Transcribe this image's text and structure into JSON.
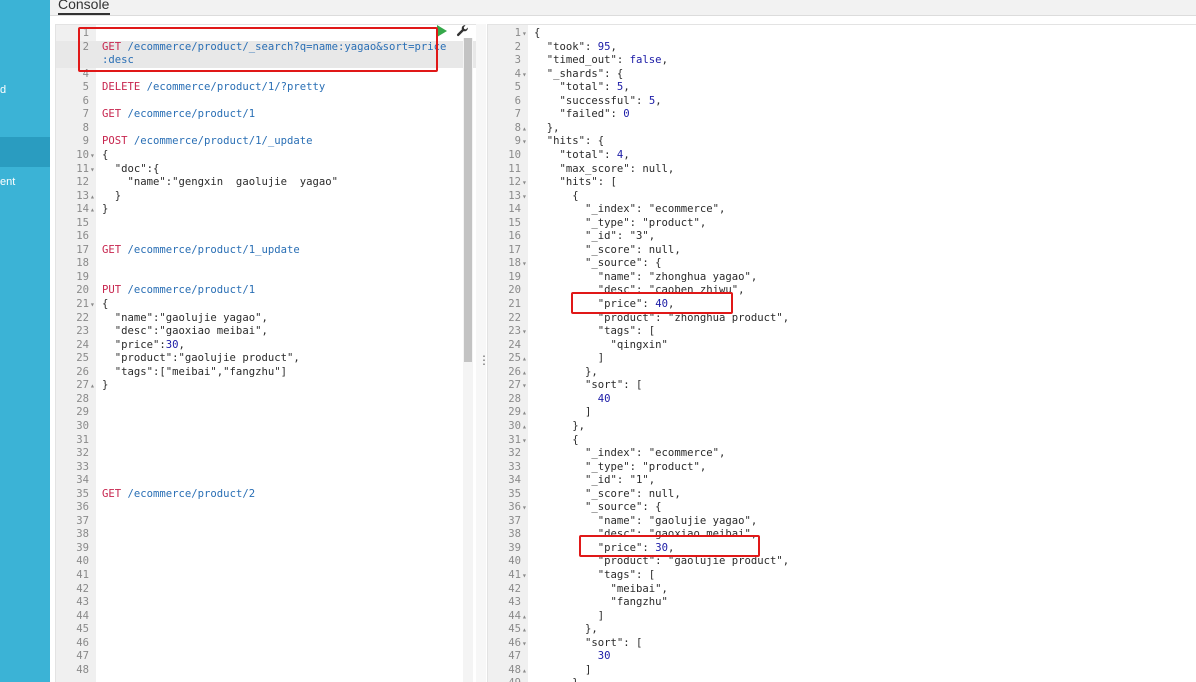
{
  "sidebar": {
    "items": [
      {
        "label": "d"
      },
      {
        "label": "ent"
      }
    ]
  },
  "tabs": {
    "console_label": "Console"
  },
  "request_editor": {
    "lines": [
      {
        "n": "1",
        "fold": "",
        "parts": []
      },
      {
        "n": "2",
        "fold": "",
        "parts": [
          {
            "c": "m",
            "t": "GET "
          },
          {
            "c": "u",
            "t": "/ecommerce/product/_search?q=name:yagao&sort=price"
          }
        ]
      },
      {
        "n": "",
        "fold": "",
        "parts": [
          {
            "c": "u",
            "t": ":desc"
          }
        ]
      },
      {
        "n": "4",
        "fold": "",
        "parts": []
      },
      {
        "n": "5",
        "fold": "",
        "parts": [
          {
            "c": "m",
            "t": "DELETE "
          },
          {
            "c": "u",
            "t": "/ecommerce/product/1/?pretty"
          }
        ]
      },
      {
        "n": "6",
        "fold": "",
        "parts": []
      },
      {
        "n": "7",
        "fold": "",
        "parts": [
          {
            "c": "m",
            "t": "GET "
          },
          {
            "c": "u",
            "t": "/ecommerce/product/1"
          }
        ]
      },
      {
        "n": "8",
        "fold": "",
        "parts": []
      },
      {
        "n": "9",
        "fold": "",
        "parts": [
          {
            "c": "m",
            "t": "POST "
          },
          {
            "c": "u",
            "t": "/ecommerce/product/1/_update"
          }
        ]
      },
      {
        "n": "10",
        "fold": "▾",
        "parts": [
          {
            "c": "k",
            "t": "{"
          }
        ]
      },
      {
        "n": "11",
        "fold": "▾",
        "parts": [
          {
            "c": "k",
            "t": "  \"doc\":{"
          }
        ]
      },
      {
        "n": "12",
        "fold": "",
        "parts": [
          {
            "c": "k",
            "t": "    \"name\":\"gengxin  gaolujie  yagao\""
          }
        ]
      },
      {
        "n": "13",
        "fold": "▴",
        "parts": [
          {
            "c": "k",
            "t": "  }"
          }
        ]
      },
      {
        "n": "14",
        "fold": "▴",
        "parts": [
          {
            "c": "k",
            "t": "}"
          }
        ]
      },
      {
        "n": "15",
        "fold": "",
        "parts": []
      },
      {
        "n": "16",
        "fold": "",
        "parts": []
      },
      {
        "n": "17",
        "fold": "",
        "parts": [
          {
            "c": "m",
            "t": "GET "
          },
          {
            "c": "u",
            "t": "/ecommerce/product/1_update"
          }
        ]
      },
      {
        "n": "18",
        "fold": "",
        "parts": []
      },
      {
        "n": "19",
        "fold": "",
        "parts": []
      },
      {
        "n": "20",
        "fold": "",
        "parts": [
          {
            "c": "m",
            "t": "PUT "
          },
          {
            "c": "u",
            "t": "/ecommerce/product/1"
          }
        ]
      },
      {
        "n": "21",
        "fold": "▾",
        "parts": [
          {
            "c": "k",
            "t": "{"
          }
        ]
      },
      {
        "n": "22",
        "fold": "",
        "parts": [
          {
            "c": "k",
            "t": "  \"name\":\"gaolujie yagao\","
          }
        ]
      },
      {
        "n": "23",
        "fold": "",
        "parts": [
          {
            "c": "k",
            "t": "  \"desc\":\"gaoxiao meibai\","
          }
        ]
      },
      {
        "n": "24",
        "fold": "",
        "parts": [
          {
            "c": "k",
            "t": "  \"price\":"
          },
          {
            "c": "n",
            "t": "30"
          },
          {
            "c": "k",
            "t": ","
          }
        ]
      },
      {
        "n": "25",
        "fold": "",
        "parts": [
          {
            "c": "k",
            "t": "  \"product\":\"gaolujie product\","
          }
        ]
      },
      {
        "n": "26",
        "fold": "",
        "parts": [
          {
            "c": "k",
            "t": "  \"tags\":[\"meibai\",\"fangzhu\"]"
          }
        ]
      },
      {
        "n": "27",
        "fold": "▴",
        "parts": [
          {
            "c": "k",
            "t": "}"
          }
        ]
      },
      {
        "n": "28",
        "fold": "",
        "parts": []
      },
      {
        "n": "29",
        "fold": "",
        "parts": []
      },
      {
        "n": "30",
        "fold": "",
        "parts": []
      },
      {
        "n": "31",
        "fold": "",
        "parts": []
      },
      {
        "n": "32",
        "fold": "",
        "parts": []
      },
      {
        "n": "33",
        "fold": "",
        "parts": []
      },
      {
        "n": "34",
        "fold": "",
        "parts": []
      },
      {
        "n": "35",
        "fold": "",
        "parts": [
          {
            "c": "m",
            "t": "GET "
          },
          {
            "c": "u",
            "t": "/ecommerce/product/2"
          }
        ]
      },
      {
        "n": "36",
        "fold": "",
        "parts": []
      },
      {
        "n": "37",
        "fold": "",
        "parts": []
      },
      {
        "n": "38",
        "fold": "",
        "parts": []
      },
      {
        "n": "39",
        "fold": "",
        "parts": []
      },
      {
        "n": "40",
        "fold": "",
        "parts": []
      },
      {
        "n": "41",
        "fold": "",
        "parts": []
      },
      {
        "n": "42",
        "fold": "",
        "parts": []
      },
      {
        "n": "43",
        "fold": "",
        "parts": []
      },
      {
        "n": "44",
        "fold": "",
        "parts": []
      },
      {
        "n": "45",
        "fold": "",
        "parts": []
      },
      {
        "n": "46",
        "fold": "",
        "parts": []
      },
      {
        "n": "47",
        "fold": "",
        "parts": []
      },
      {
        "n": "48",
        "fold": "",
        "parts": []
      }
    ]
  },
  "response_viewer": {
    "lines": [
      {
        "n": "1",
        "fold": "▾",
        "parts": [
          {
            "c": "k",
            "t": "{"
          }
        ]
      },
      {
        "n": "2",
        "fold": "",
        "parts": [
          {
            "c": "k",
            "t": "  \"took\": "
          },
          {
            "c": "n",
            "t": "95"
          },
          {
            "c": "k",
            "t": ","
          }
        ]
      },
      {
        "n": "3",
        "fold": "",
        "parts": [
          {
            "c": "k",
            "t": "  \"timed_out\": "
          },
          {
            "c": "b",
            "t": "false"
          },
          {
            "c": "k",
            "t": ","
          }
        ]
      },
      {
        "n": "4",
        "fold": "▾",
        "parts": [
          {
            "c": "k",
            "t": "  \"_shards\": {"
          }
        ]
      },
      {
        "n": "5",
        "fold": "",
        "parts": [
          {
            "c": "k",
            "t": "    \"total\": "
          },
          {
            "c": "n",
            "t": "5"
          },
          {
            "c": "k",
            "t": ","
          }
        ]
      },
      {
        "n": "6",
        "fold": "",
        "parts": [
          {
            "c": "k",
            "t": "    \"successful\": "
          },
          {
            "c": "n",
            "t": "5"
          },
          {
            "c": "k",
            "t": ","
          }
        ]
      },
      {
        "n": "7",
        "fold": "",
        "parts": [
          {
            "c": "k",
            "t": "    \"failed\": "
          },
          {
            "c": "n",
            "t": "0"
          }
        ]
      },
      {
        "n": "8",
        "fold": "▴",
        "parts": [
          {
            "c": "k",
            "t": "  },"
          }
        ]
      },
      {
        "n": "9",
        "fold": "▾",
        "parts": [
          {
            "c": "k",
            "t": "  \"hits\": {"
          }
        ]
      },
      {
        "n": "10",
        "fold": "",
        "parts": [
          {
            "c": "k",
            "t": "    \"total\": "
          },
          {
            "c": "n",
            "t": "4"
          },
          {
            "c": "k",
            "t": ","
          }
        ]
      },
      {
        "n": "11",
        "fold": "",
        "parts": [
          {
            "c": "k",
            "t": "    \"max_score\": null,"
          }
        ]
      },
      {
        "n": "12",
        "fold": "▾",
        "parts": [
          {
            "c": "k",
            "t": "    \"hits\": ["
          }
        ]
      },
      {
        "n": "13",
        "fold": "▾",
        "parts": [
          {
            "c": "k",
            "t": "      {"
          }
        ]
      },
      {
        "n": "14",
        "fold": "",
        "parts": [
          {
            "c": "k",
            "t": "        \"_index\": \"ecommerce\","
          }
        ]
      },
      {
        "n": "15",
        "fold": "",
        "parts": [
          {
            "c": "k",
            "t": "        \"_type\": \"product\","
          }
        ]
      },
      {
        "n": "16",
        "fold": "",
        "parts": [
          {
            "c": "k",
            "t": "        \"_id\": \"3\","
          }
        ]
      },
      {
        "n": "17",
        "fold": "",
        "parts": [
          {
            "c": "k",
            "t": "        \"_score\": null,"
          }
        ]
      },
      {
        "n": "18",
        "fold": "▾",
        "parts": [
          {
            "c": "k",
            "t": "        \"_source\": {"
          }
        ]
      },
      {
        "n": "19",
        "fold": "",
        "parts": [
          {
            "c": "k",
            "t": "          \"name\": \"zhonghua yagao\","
          }
        ]
      },
      {
        "n": "20",
        "fold": "",
        "parts": [
          {
            "c": "k",
            "t": "          \"desc\": \"caoben zhiwu\","
          }
        ]
      },
      {
        "n": "21",
        "fold": "",
        "parts": [
          {
            "c": "k",
            "t": "          \"price\": "
          },
          {
            "c": "n",
            "t": "40"
          },
          {
            "c": "k",
            "t": ","
          }
        ]
      },
      {
        "n": "22",
        "fold": "",
        "parts": [
          {
            "c": "k",
            "t": "          \"product\": \"zhonghua product\","
          }
        ]
      },
      {
        "n": "23",
        "fold": "▾",
        "parts": [
          {
            "c": "k",
            "t": "          \"tags\": ["
          }
        ]
      },
      {
        "n": "24",
        "fold": "",
        "parts": [
          {
            "c": "k",
            "t": "            \"qingxin\""
          }
        ]
      },
      {
        "n": "25",
        "fold": "▴",
        "parts": [
          {
            "c": "k",
            "t": "          ]"
          }
        ]
      },
      {
        "n": "26",
        "fold": "▴",
        "parts": [
          {
            "c": "k",
            "t": "        },"
          }
        ]
      },
      {
        "n": "27",
        "fold": "▾",
        "parts": [
          {
            "c": "k",
            "t": "        \"sort\": ["
          }
        ]
      },
      {
        "n": "28",
        "fold": "",
        "parts": [
          {
            "c": "k",
            "t": "          "
          },
          {
            "c": "n",
            "t": "40"
          }
        ]
      },
      {
        "n": "29",
        "fold": "▴",
        "parts": [
          {
            "c": "k",
            "t": "        ]"
          }
        ]
      },
      {
        "n": "30",
        "fold": "▴",
        "parts": [
          {
            "c": "k",
            "t": "      },"
          }
        ]
      },
      {
        "n": "31",
        "fold": "▾",
        "parts": [
          {
            "c": "k",
            "t": "      {"
          }
        ]
      },
      {
        "n": "32",
        "fold": "",
        "parts": [
          {
            "c": "k",
            "t": "        \"_index\": \"ecommerce\","
          }
        ]
      },
      {
        "n": "33",
        "fold": "",
        "parts": [
          {
            "c": "k",
            "t": "        \"_type\": \"product\","
          }
        ]
      },
      {
        "n": "34",
        "fold": "",
        "parts": [
          {
            "c": "k",
            "t": "        \"_id\": \"1\","
          }
        ]
      },
      {
        "n": "35",
        "fold": "",
        "parts": [
          {
            "c": "k",
            "t": "        \"_score\": null,"
          }
        ]
      },
      {
        "n": "36",
        "fold": "▾",
        "parts": [
          {
            "c": "k",
            "t": "        \"_source\": {"
          }
        ]
      },
      {
        "n": "37",
        "fold": "",
        "parts": [
          {
            "c": "k",
            "t": "          \"name\": \"gaolujie yagao\","
          }
        ]
      },
      {
        "n": "38",
        "fold": "",
        "parts": [
          {
            "c": "k",
            "t": "          \"desc\": \"gaoxiao meibai\","
          }
        ]
      },
      {
        "n": "39",
        "fold": "",
        "parts": [
          {
            "c": "k",
            "t": "          \"price\": "
          },
          {
            "c": "n",
            "t": "30"
          },
          {
            "c": "k",
            "t": ","
          }
        ]
      },
      {
        "n": "40",
        "fold": "",
        "parts": [
          {
            "c": "k",
            "t": "          \"product\": \"gaolujie product\","
          }
        ]
      },
      {
        "n": "41",
        "fold": "▾",
        "parts": [
          {
            "c": "k",
            "t": "          \"tags\": ["
          }
        ]
      },
      {
        "n": "42",
        "fold": "",
        "parts": [
          {
            "c": "k",
            "t": "            \"meibai\","
          }
        ]
      },
      {
        "n": "43",
        "fold": "",
        "parts": [
          {
            "c": "k",
            "t": "            \"fangzhu\""
          }
        ]
      },
      {
        "n": "44",
        "fold": "▴",
        "parts": [
          {
            "c": "k",
            "t": "          ]"
          }
        ]
      },
      {
        "n": "45",
        "fold": "▴",
        "parts": [
          {
            "c": "k",
            "t": "        },"
          }
        ]
      },
      {
        "n": "46",
        "fold": "▾",
        "parts": [
          {
            "c": "k",
            "t": "        \"sort\": ["
          }
        ]
      },
      {
        "n": "47",
        "fold": "",
        "parts": [
          {
            "c": "k",
            "t": "          "
          },
          {
            "c": "n",
            "t": "30"
          }
        ]
      },
      {
        "n": "48",
        "fold": "▴",
        "parts": [
          {
            "c": "k",
            "t": "        ]"
          }
        ]
      },
      {
        "n": "49",
        "fold": "▴",
        "parts": [
          {
            "c": "k",
            "t": "      }"
          }
        ]
      }
    ]
  },
  "icons": {
    "run": "play-icon",
    "settings": "wrench-icon",
    "splitter": "drag-handle-icon"
  },
  "colors": {
    "sidebar": "#3bb3d6",
    "method": "#c7254e",
    "url": "#2a6fb5",
    "number": "#1a1aa6",
    "annotation": "#e01818"
  }
}
